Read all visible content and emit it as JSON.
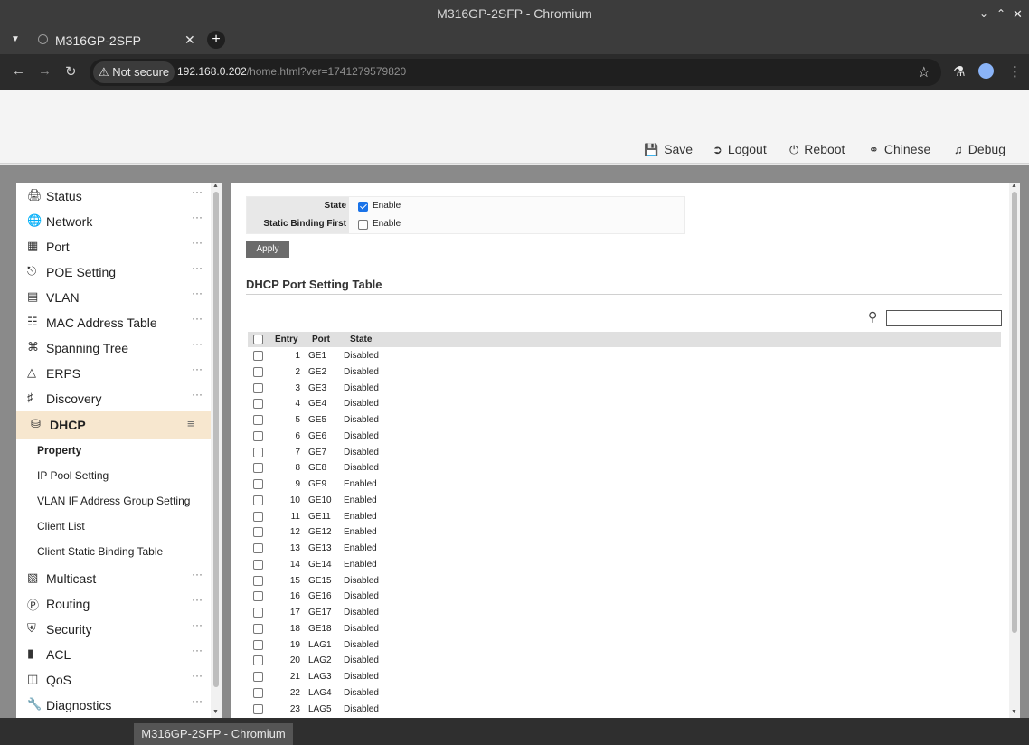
{
  "window": {
    "title": "M316GP-2SFP - Chromium"
  },
  "browser": {
    "tab_title": "M316GP-2SFP",
    "security_label": "Not secure",
    "url_host": "192.168.0.202",
    "url_path": "/home.html?ver=1741279579820"
  },
  "header": {
    "buttons": [
      {
        "label": "Save",
        "icon": "save-icon"
      },
      {
        "label": "Logout",
        "icon": "logout-icon"
      },
      {
        "label": "Reboot",
        "icon": "power-icon"
      },
      {
        "label": "Chinese",
        "icon": "globe-icon"
      },
      {
        "label": "Debug",
        "icon": "bell-icon"
      }
    ]
  },
  "sidebar": {
    "items": [
      {
        "label": "Status",
        "icon": "monitor-icon"
      },
      {
        "label": "Network",
        "icon": "globe-icon"
      },
      {
        "label": "Port",
        "icon": "port-icon"
      },
      {
        "label": "POE Setting",
        "icon": "plug-icon"
      },
      {
        "label": "VLAN",
        "icon": "vlan-icon"
      },
      {
        "label": "MAC Address Table",
        "icon": "table-icon"
      },
      {
        "label": "Spanning Tree",
        "icon": "tree-icon"
      },
      {
        "label": "ERPS",
        "icon": "ring-icon"
      },
      {
        "label": "Discovery",
        "icon": "topology-icon"
      },
      {
        "label": "DHCP",
        "icon": "database-icon"
      },
      {
        "label": "Multicast",
        "icon": "multicast-icon"
      },
      {
        "label": "Routing",
        "icon": "routing-icon"
      },
      {
        "label": "Security",
        "icon": "shield-icon"
      },
      {
        "label": "ACL",
        "icon": "acl-icon"
      },
      {
        "label": "QoS",
        "icon": "qos-icon"
      },
      {
        "label": "Diagnostics",
        "icon": "wrench-icon"
      }
    ],
    "dhcp_sub": [
      "Property",
      "IP Pool Setting",
      "VLAN IF Address Group Setting",
      "Client List",
      "Client Static Binding Table"
    ]
  },
  "form": {
    "state_label": "State",
    "state_value": "Enable",
    "state_checked": true,
    "static_label": "Static Binding First",
    "static_value": "Enable",
    "static_checked": false,
    "apply_label": "Apply"
  },
  "table": {
    "title": "DHCP Port Setting Table",
    "columns": [
      "Entry",
      "Port",
      "State"
    ],
    "rows": [
      [
        "1",
        "GE1",
        "Disabled"
      ],
      [
        "2",
        "GE2",
        "Disabled"
      ],
      [
        "3",
        "GE3",
        "Disabled"
      ],
      [
        "4",
        "GE4",
        "Disabled"
      ],
      [
        "5",
        "GE5",
        "Disabled"
      ],
      [
        "6",
        "GE6",
        "Disabled"
      ],
      [
        "7",
        "GE7",
        "Disabled"
      ],
      [
        "8",
        "GE8",
        "Disabled"
      ],
      [
        "9",
        "GE9",
        "Enabled"
      ],
      [
        "10",
        "GE10",
        "Enabled"
      ],
      [
        "11",
        "GE11",
        "Enabled"
      ],
      [
        "12",
        "GE12",
        "Enabled"
      ],
      [
        "13",
        "GE13",
        "Enabled"
      ],
      [
        "14",
        "GE14",
        "Enabled"
      ],
      [
        "15",
        "GE15",
        "Disabled"
      ],
      [
        "16",
        "GE16",
        "Disabled"
      ],
      [
        "17",
        "GE17",
        "Disabled"
      ],
      [
        "18",
        "GE18",
        "Disabled"
      ],
      [
        "19",
        "LAG1",
        "Disabled"
      ],
      [
        "20",
        "LAG2",
        "Disabled"
      ],
      [
        "21",
        "LAG3",
        "Disabled"
      ],
      [
        "22",
        "LAG4",
        "Disabled"
      ],
      [
        "23",
        "LAG5",
        "Disabled"
      ]
    ]
  },
  "taskbar": {
    "task_label": "M316GP-2SFP - Chromium"
  }
}
